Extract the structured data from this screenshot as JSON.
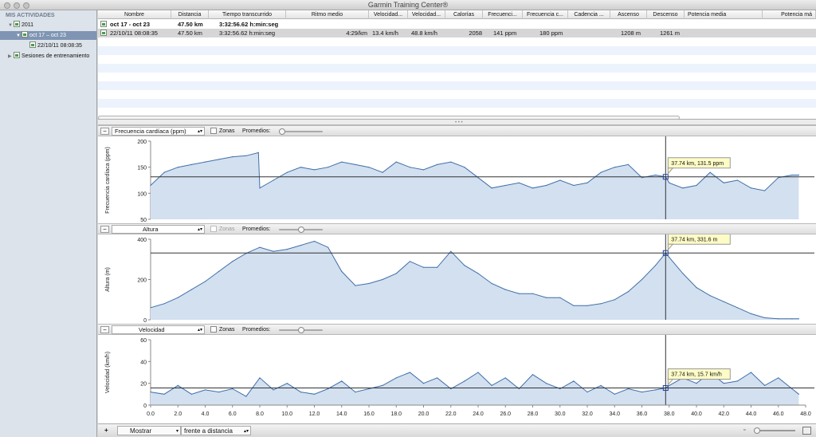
{
  "window": {
    "title": "Garmin Training Center®"
  },
  "sidebar": {
    "heading": "MIS ACTIVIDADES",
    "items": [
      {
        "label": "2011"
      },
      {
        "label": "oct 17 – oct 23"
      },
      {
        "label": "22/10/11 08:08:35"
      },
      {
        "label": "Sesiones de entrenamiento"
      }
    ]
  },
  "table": {
    "columns": [
      "Nombre",
      "Distancia",
      "Tiempo transcurrido",
      "Ritmo medio",
      "Velocidad...",
      "Velocidad...",
      "Calorías",
      "Frecuenci...",
      "Frecuencia c...",
      "Cadencia ...",
      "Ascenso",
      "Descenso",
      "Potencia media",
      "Potencia má"
    ],
    "rows": [
      {
        "name": "oct 17 - oct 23",
        "distance": "47.50 km",
        "time": "3:32:56.62 h:min:seg",
        "pace": "",
        "avg_speed": "",
        "max_speed": "",
        "calories": "",
        "avg_hr": "",
        "max_hr": "",
        "cadence": "",
        "ascent": "",
        "descent": ""
      },
      {
        "name": "22/10/11 08:08:35",
        "distance": "47.50 km",
        "time": "3:32:56.62 h:min:seg",
        "pace": "4:29/km",
        "avg_speed": "13.4 km/h",
        "max_speed": "48.8 km/h",
        "calories": "2058",
        "avg_hr": "141 ppm",
        "max_hr": "180 ppm",
        "cadence": "",
        "ascent": "1208 m",
        "descent": "1261 m"
      }
    ]
  },
  "panels": [
    {
      "selector": "Frecuencia cardíaca (ppm)",
      "zones_label": "Zonas",
      "zones_enabled": true,
      "averages_label": "Promedios:",
      "averages_slider": 0.0,
      "ylabel": "Frecuencia cardíaca (ppm)",
      "yticks": [
        "200",
        "150",
        "100",
        "50"
      ],
      "tooltip": "37.74 km, 131.5 ppm"
    },
    {
      "selector": "Altura",
      "zones_label": "Zonas",
      "zones_enabled": false,
      "averages_label": "Promedios:",
      "averages_slider": 0.45,
      "ylabel": "Altura (m)",
      "yticks": [
        "400",
        "200",
        "0"
      ],
      "tooltip": "37.74 km, 331.6 m"
    },
    {
      "selector": "Velocidad",
      "zones_label": "Zonas",
      "zones_enabled": true,
      "averages_label": "Promedios:",
      "averages_slider": 0.45,
      "ylabel": "Velocidad (km/h)",
      "yticks": [
        "60",
        "40",
        "20",
        "0"
      ],
      "tooltip": "37.74 km, 15.7 km/h"
    }
  ],
  "xaxis": {
    "ticks": [
      "0.0",
      "2.0",
      "4.0",
      "6.0",
      "8.0",
      "10.0",
      "12.0",
      "14.0",
      "16.0",
      "18.0",
      "20.0",
      "22.0",
      "24.0",
      "26.0",
      "28.0",
      "30.0",
      "32.0",
      "34.0",
      "36.0",
      "38.0",
      "40.0",
      "42.0",
      "44.0",
      "46.0",
      "48.0"
    ]
  },
  "bottom": {
    "add": "+",
    "show_label": "Mostrar",
    "against_label": "frente a distancia"
  },
  "colors": {
    "line": "#3f6fa8",
    "fill": "#d3e0f0",
    "tooltip_bg": "#fdfbc6",
    "selection": "#7f95b3"
  },
  "chart_data": [
    {
      "type": "area",
      "ylabel": "Frecuencia cardíaca (ppm)",
      "ylim": [
        50,
        200
      ],
      "xlim": [
        0,
        48
      ],
      "cursor_x": 37.74,
      "cursor_y": 131.5,
      "x": [
        0,
        1,
        2,
        3,
        4,
        5,
        6,
        7,
        7.9,
        8,
        9,
        10,
        11,
        12,
        13,
        14,
        15,
        16,
        17,
        18,
        19,
        20,
        21,
        22,
        23,
        24,
        25,
        26,
        27,
        28,
        29,
        30,
        31,
        32,
        33,
        34,
        35,
        36,
        37,
        37.74,
        38,
        39,
        40,
        41,
        42,
        43,
        44,
        45,
        46,
        47,
        47.5
      ],
      "y": [
        115,
        140,
        150,
        155,
        160,
        165,
        170,
        172,
        178,
        110,
        125,
        140,
        150,
        145,
        150,
        160,
        155,
        150,
        140,
        160,
        150,
        145,
        155,
        160,
        150,
        130,
        110,
        115,
        120,
        110,
        115,
        125,
        115,
        120,
        140,
        150,
        155,
        130,
        135,
        131.5,
        120,
        110,
        115,
        140,
        120,
        125,
        110,
        105,
        130,
        135,
        135
      ]
    },
    {
      "type": "area",
      "ylabel": "Altura (m)",
      "ylim": [
        0,
        400
      ],
      "xlim": [
        0,
        48
      ],
      "cursor_x": 37.74,
      "cursor_y": 331.6,
      "x": [
        0,
        1,
        2,
        3,
        4,
        5,
        6,
        7,
        8,
        9,
        10,
        11,
        12,
        13,
        14,
        15,
        16,
        17,
        18,
        19,
        20,
        21,
        22,
        23,
        24,
        25,
        26,
        27,
        28,
        29,
        30,
        31,
        32,
        33,
        34,
        35,
        36,
        37,
        37.74,
        38,
        39,
        40,
        41,
        42,
        43,
        44,
        45,
        46,
        47,
        47.5
      ],
      "y": [
        60,
        80,
        110,
        150,
        190,
        240,
        290,
        330,
        360,
        340,
        350,
        370,
        390,
        360,
        240,
        170,
        180,
        200,
        230,
        290,
        260,
        260,
        340,
        270,
        230,
        180,
        150,
        130,
        130,
        110,
        110,
        70,
        70,
        80,
        100,
        140,
        200,
        270,
        331.6,
        310,
        230,
        160,
        120,
        90,
        60,
        30,
        10,
        5,
        5,
        5
      ]
    },
    {
      "type": "area",
      "ylabel": "Velocidad (km/h)",
      "ylim": [
        0,
        60
      ],
      "xlim": [
        0,
        48
      ],
      "cursor_x": 37.74,
      "cursor_y": 15.7,
      "x": [
        0,
        1,
        2,
        3,
        4,
        5,
        6,
        7,
        8,
        9,
        10,
        11,
        12,
        13,
        14,
        15,
        16,
        17,
        18,
        19,
        20,
        21,
        22,
        23,
        24,
        25,
        26,
        27,
        28,
        29,
        30,
        31,
        32,
        33,
        34,
        35,
        36,
        37,
        37.74,
        38,
        39,
        40,
        41,
        42,
        43,
        44,
        45,
        46,
        47,
        47.5
      ],
      "y": [
        12,
        10,
        18,
        10,
        14,
        12,
        15,
        8,
        25,
        14,
        20,
        12,
        10,
        15,
        22,
        12,
        15,
        18,
        25,
        30,
        20,
        25,
        15,
        22,
        30,
        18,
        25,
        15,
        28,
        20,
        15,
        22,
        12,
        18,
        10,
        15,
        12,
        14,
        15.7,
        18,
        25,
        20,
        30,
        20,
        22,
        30,
        18,
        25,
        15,
        10
      ]
    }
  ]
}
